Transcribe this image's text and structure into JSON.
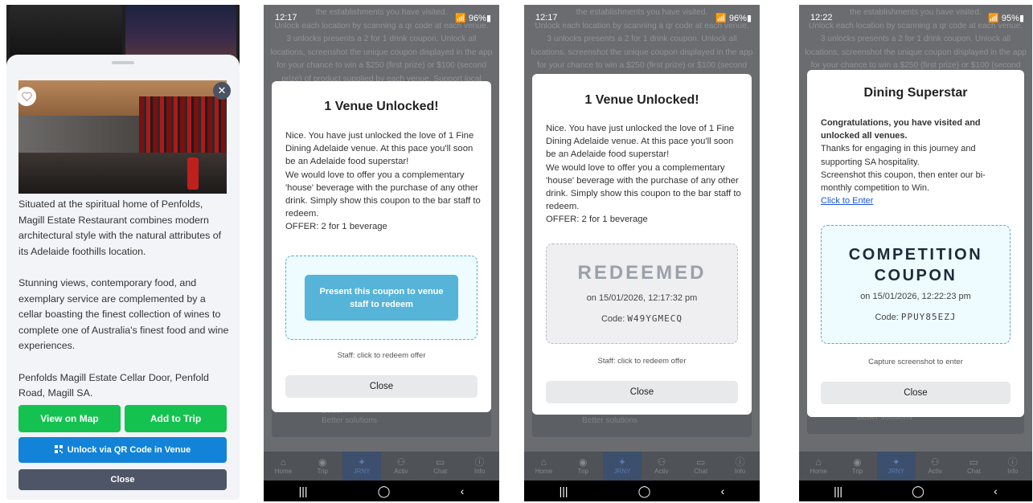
{
  "venue_sheet": {
    "description": [
      "Situated at the spiritual home of Penfolds, Magill Estate Restaurant combines modern architectural style with the natural attributes of its Adelaide foothills location.",
      "Stunning views, contemporary food, and exemplary service are complemented by a cellar boasting the finest collection of wines to complete one of Australia's finest food and wine experiences.",
      "Penfolds Magill Estate Cellar Door, Penfold Road, Magill SA."
    ],
    "view_on_map": "View on Map",
    "add_to_trip": "Add to Trip",
    "unlock_qr": "Unlock via QR Code in Venue",
    "close": "Close"
  },
  "background_text": {
    "lines": [
      "the establishments you have visited.",
      "Unlock each location by scanning a qr code at each venue.",
      "3 unlocks presents a 2 for 1 drink coupon. Unlock all",
      "locations, screenshot the unique coupon displayed in the app",
      "for your chance to win a $250 (first prize) or $100 (second",
      "prize) of product supplied by each venue. Support local"
    ],
    "card_title": "Better",
    "card_subtitle": "Better solutions"
  },
  "nav": {
    "items": [
      "Home",
      "Trip",
      "JRNY",
      "Activ",
      "Chat",
      "Info"
    ]
  },
  "screens": [
    {
      "time": "12:17",
      "battery": "96%",
      "title": "1 Venue Unlocked!",
      "body": [
        "Nice. You have just unlocked the love of 1 Fine Dining Adelaide venue. At this pace you'll soon be an Adelaide food superstar!",
        "We would love to offer you a complementary 'house' beverage with the purchase of any other drink. Simply show this coupon to the bar staff to redeem.",
        "OFFER: 2 for 1 beverage"
      ],
      "present_button": "Present this coupon to venue staff to redeem",
      "hint": "Staff: click to redeem offer",
      "close": "Close"
    },
    {
      "time": "12:17",
      "battery": "96%",
      "title": "1 Venue Unlocked!",
      "body": [
        "Nice. You have just unlocked the love of 1 Fine Dining Adelaide venue. At this pace you'll soon be an Adelaide food superstar!",
        "We would love to offer you a complementary 'house' beverage with the purchase of any other drink. Simply show this coupon to the bar staff to redeem.",
        "OFFER: 2 for 1 beverage"
      ],
      "redeemed": "REDEEMED",
      "timestamp": "on 15/01/2026, 12:17:32 pm",
      "code_label": "Code:",
      "code": "W49YGMECQ",
      "hint": "Staff: click to redeem offer",
      "close": "Close"
    },
    {
      "time": "12:22",
      "battery": "95%",
      "title": "Dining Superstar",
      "congrats": "Congratulations, you have visited and unlocked all venues.",
      "body": [
        "Thanks for engaging in this journey and supporting SA hospitality.",
        "Screenshot this coupon, then enter our bi-monthly competition to Win."
      ],
      "link": "Click to Enter",
      "coupon_line1": "COMPETITION",
      "coupon_line2": "COUPON",
      "timestamp": "on 15/01/2026, 12:22:23 pm",
      "code_label": "Code:",
      "code": "PPUY85EZJ",
      "hint": "Capture screenshot to enter",
      "close": "Close"
    }
  ],
  "colors": {
    "green": "#14c250",
    "blue": "#1283d8",
    "slate": "#4e5566",
    "coupon_border": "#4fa9d6",
    "present_button": "#56b4d8"
  }
}
